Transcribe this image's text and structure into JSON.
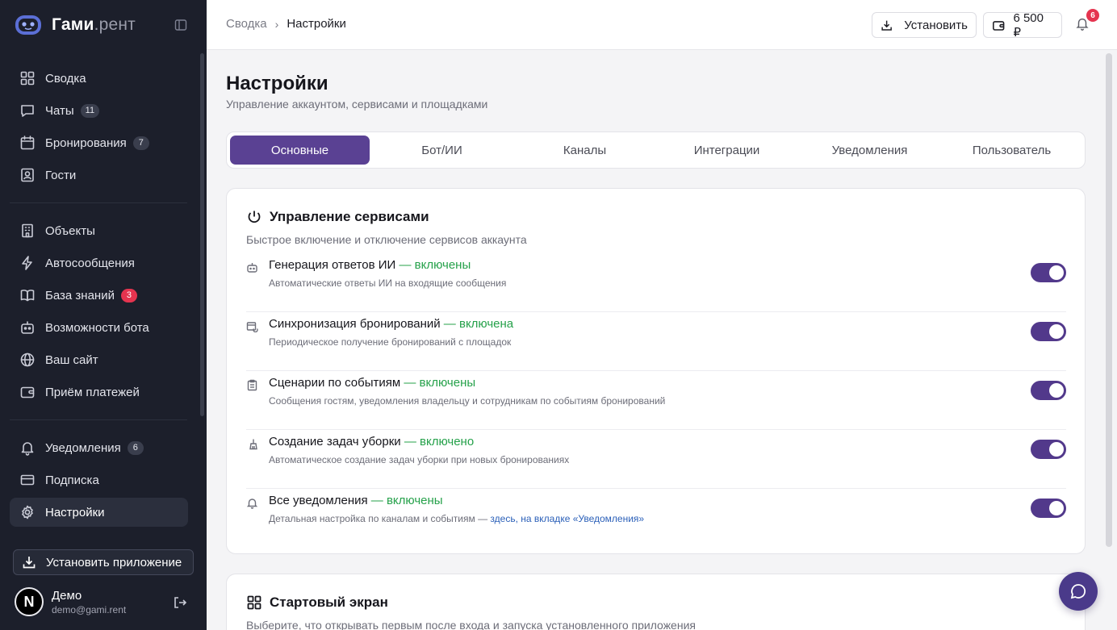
{
  "brand": {
    "name": "Гами",
    "suffix": ".рент"
  },
  "sidebar": {
    "nav_group_1": [
      {
        "label": "Сводка",
        "icon": "dashboard-icon"
      },
      {
        "label": "Чаты",
        "icon": "chat-icon",
        "badge": "11"
      },
      {
        "label": "Бронирования",
        "icon": "calendar-icon",
        "badge": "7"
      },
      {
        "label": "Гости",
        "icon": "guest-icon"
      }
    ],
    "nav_group_2": [
      {
        "label": "Объекты",
        "icon": "building-icon"
      },
      {
        "label": "Автосообщения",
        "icon": "lightning-icon"
      },
      {
        "label": "База знаний",
        "icon": "book-icon",
        "badge": "3"
      },
      {
        "label": "Возможности бота",
        "icon": "bot-icon"
      },
      {
        "label": "Ваш сайт",
        "icon": "globe-icon"
      },
      {
        "label": "Приём платежей",
        "icon": "wallet-icon"
      }
    ],
    "nav_group_3": [
      {
        "label": "Уведомления",
        "icon": "bell-icon",
        "badge": "6"
      },
      {
        "label": "Подписка",
        "icon": "card-icon"
      },
      {
        "label": "Настройки",
        "icon": "gear-icon",
        "active": true
      }
    ],
    "install_label": "Установить приложение",
    "user": {
      "initial": "N",
      "name": "Демо",
      "email": "demo@gami.rent"
    }
  },
  "header": {
    "breadcrumb": {
      "parent": "Сводка",
      "current": "Настройки"
    },
    "install_label": "Установить",
    "balance": "6 500 ₽",
    "notifications_count": "6"
  },
  "page": {
    "title": "Настройки",
    "subtitle": "Управление аккаунтом, сервисами и площадками"
  },
  "tabs": [
    "Основные",
    "Бот/ИИ",
    "Каналы",
    "Интеграции",
    "Уведомления",
    "Пользователь"
  ],
  "services_card": {
    "title": "Управление сервисами",
    "description": "Быстрое включение и отключение сервисов аккаунта",
    "rows": [
      {
        "title": "Генерация ответов ИИ",
        "status": " — включены",
        "desc": "Автоматические ответы ИИ на входящие сообщения",
        "icon": "bot-icon",
        "enabled": true
      },
      {
        "title": "Синхронизация бронирований",
        "status": " — включена",
        "desc": "Периодическое получение бронирований с площадок",
        "icon": "calendar-sync-icon",
        "enabled": true
      },
      {
        "title": "Сценарии по событиям",
        "status": " — включены",
        "desc": "Сообщения гостям, уведомления владельцу и сотрудникам по событиям бронирований",
        "icon": "clipboard-icon",
        "enabled": true
      },
      {
        "title": "Создание задач уборки",
        "status": " — включено",
        "desc": "Автоматическое создание задач уборки при новых бронированиях",
        "icon": "broom-icon",
        "enabled": true
      },
      {
        "title": "Все уведомления",
        "status": " — включены",
        "desc": "Детальная настройка по каналам и событиям — ",
        "link": "здесь, на вкладке «Уведомления»",
        "icon": "bell-icon",
        "enabled": true
      }
    ]
  },
  "start_card": {
    "title": "Стартовый экран",
    "description": "Выберите, что открывать первым после входа и запуска установленного приложения"
  },
  "colors": {
    "accent": "#5a4193",
    "sidebar_bg": "#1c1f2b",
    "status_green": "#25a14a",
    "badge_red": "#e5344f"
  }
}
